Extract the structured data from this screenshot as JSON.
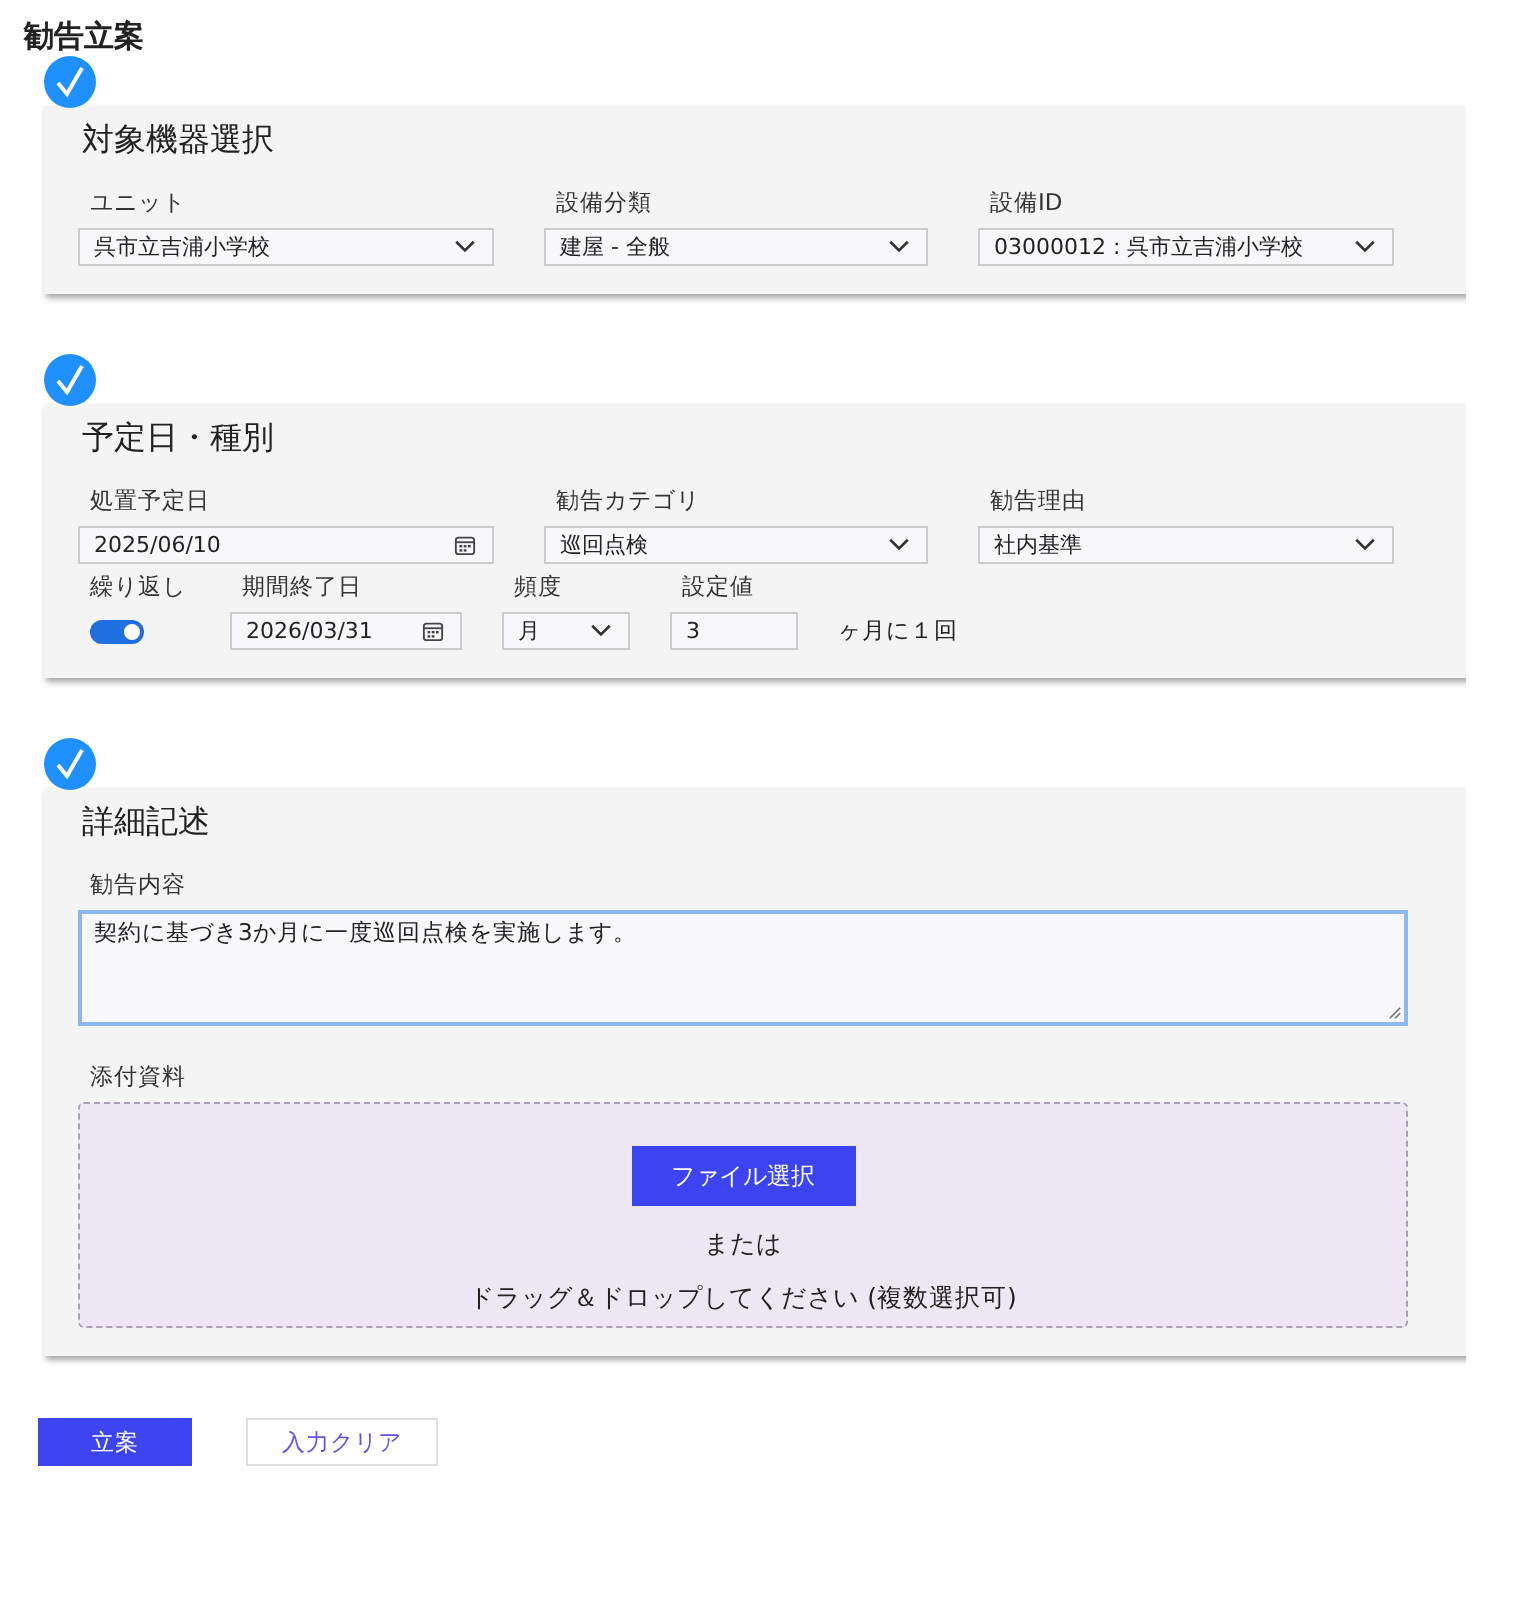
{
  "page_title": "勧告立案",
  "sections": [
    {
      "title": "対象機器選択",
      "completed": true,
      "rows": [
        [
          {
            "kind": "select",
            "label": "ユニット",
            "value": "呉市立吉浦小学校"
          },
          {
            "kind": "select",
            "label": "設備分類",
            "value": "建屋 - 全般"
          },
          {
            "kind": "select",
            "label": "設備ID",
            "value": "03000012 : 呉市立吉浦小学校"
          }
        ]
      ]
    },
    {
      "title": "予定日・種別",
      "completed": true,
      "rows": [
        [
          {
            "kind": "date",
            "label": "処置予定日",
            "value": "2025/06/10"
          },
          {
            "kind": "select",
            "label": "勧告カテゴリ",
            "value": "巡回点検"
          },
          {
            "kind": "select",
            "label": "勧告理由",
            "value": "社内基準"
          }
        ],
        [
          {
            "kind": "toggle",
            "label": "繰り返し",
            "on": true
          },
          {
            "kind": "date",
            "label": "期間終了日",
            "value": "2026/03/31"
          },
          {
            "kind": "select",
            "label": "頻度",
            "value": "月"
          },
          {
            "kind": "text",
            "label": "設定値",
            "value": "3"
          },
          {
            "kind": "note",
            "value": "ヶ月に１回"
          }
        ]
      ]
    },
    {
      "title": "詳細記述",
      "completed": true,
      "rows": [
        [
          {
            "kind": "textarea",
            "label": "勧告内容",
            "value": "契約に基づき3か月に一度巡回点検を実施します。",
            "focused": true
          }
        ],
        [
          {
            "kind": "dropzone",
            "label": "添付資料",
            "button": "ファイル選択",
            "or_text": "または",
            "hint": "ドラッグ＆ドロップしてください (複数選択可)"
          }
        ]
      ]
    }
  ],
  "actions": [
    {
      "label": "立案",
      "primary": true
    },
    {
      "label": "入力クリア",
      "primary": false
    }
  ]
}
